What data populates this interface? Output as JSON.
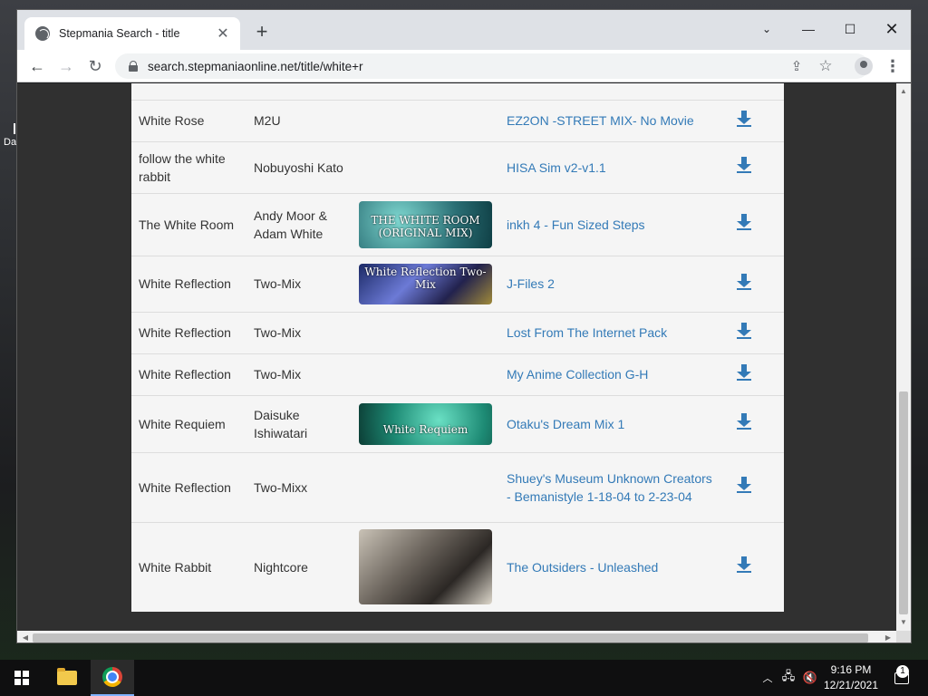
{
  "browser": {
    "tab_title": "Stepmania Search - title",
    "tab_close": "✕",
    "new_tab": "+",
    "url": "search.stepmaniaonline.net/title/white+r"
  },
  "icons": {
    "back": "←",
    "forward": "→",
    "reload": "↻",
    "share": "⇪",
    "star": "☆",
    "menu": "⋮",
    "dropdown": "⌄",
    "minimize": "—",
    "maximize": "☐",
    "close": "✕",
    "tray_chevron": "︿",
    "network": "🖧",
    "volume": "🔇"
  },
  "results": [
    {
      "title": "White Rose",
      "artist": "M2U",
      "banner": null,
      "pack": "EZ2ON -STREET MIX- No Movie"
    },
    {
      "title": "follow the white rabbit",
      "artist": "Nobuyoshi Kato",
      "banner": null,
      "pack": "HISA Sim v2-v1.1"
    },
    {
      "title": "The White Room",
      "artist": "Andy Moor & Adam White",
      "banner": "THE WHITE ROOM (ORIGINAL MIX)",
      "pack": "inkh 4 - Fun Sized Steps"
    },
    {
      "title": "White Reflection",
      "artist": "Two-Mix",
      "banner": "White Reflection Two-Mix",
      "pack": "J-Files 2"
    },
    {
      "title": "White Reflection",
      "artist": "Two-Mix",
      "banner": null,
      "pack": "Lost From The Internet Pack"
    },
    {
      "title": "White Reflection",
      "artist": "Two-Mix",
      "banner": null,
      "pack": "My Anime Collection G-H"
    },
    {
      "title": "White Requiem",
      "artist": "Daisuke Ishiwatari",
      "banner": "White Requiem",
      "pack": "Otaku's Dream Mix 1"
    },
    {
      "title": "White Reflection",
      "artist": "Two-Mixx",
      "banner": null,
      "pack": "Shuey's Museum Unknown Creators - Bemanistyle 1-18-04 to 2-23-04"
    },
    {
      "title": "White Rabbit",
      "artist": "Nightcore",
      "banner": "",
      "pack": "The Outsiders - Unleashed"
    }
  ],
  "taskbar": {
    "time": "9:16 PM",
    "date": "12/21/2021",
    "notification_count": "1"
  },
  "desktop": {
    "icon_label_fragment": "Da"
  }
}
